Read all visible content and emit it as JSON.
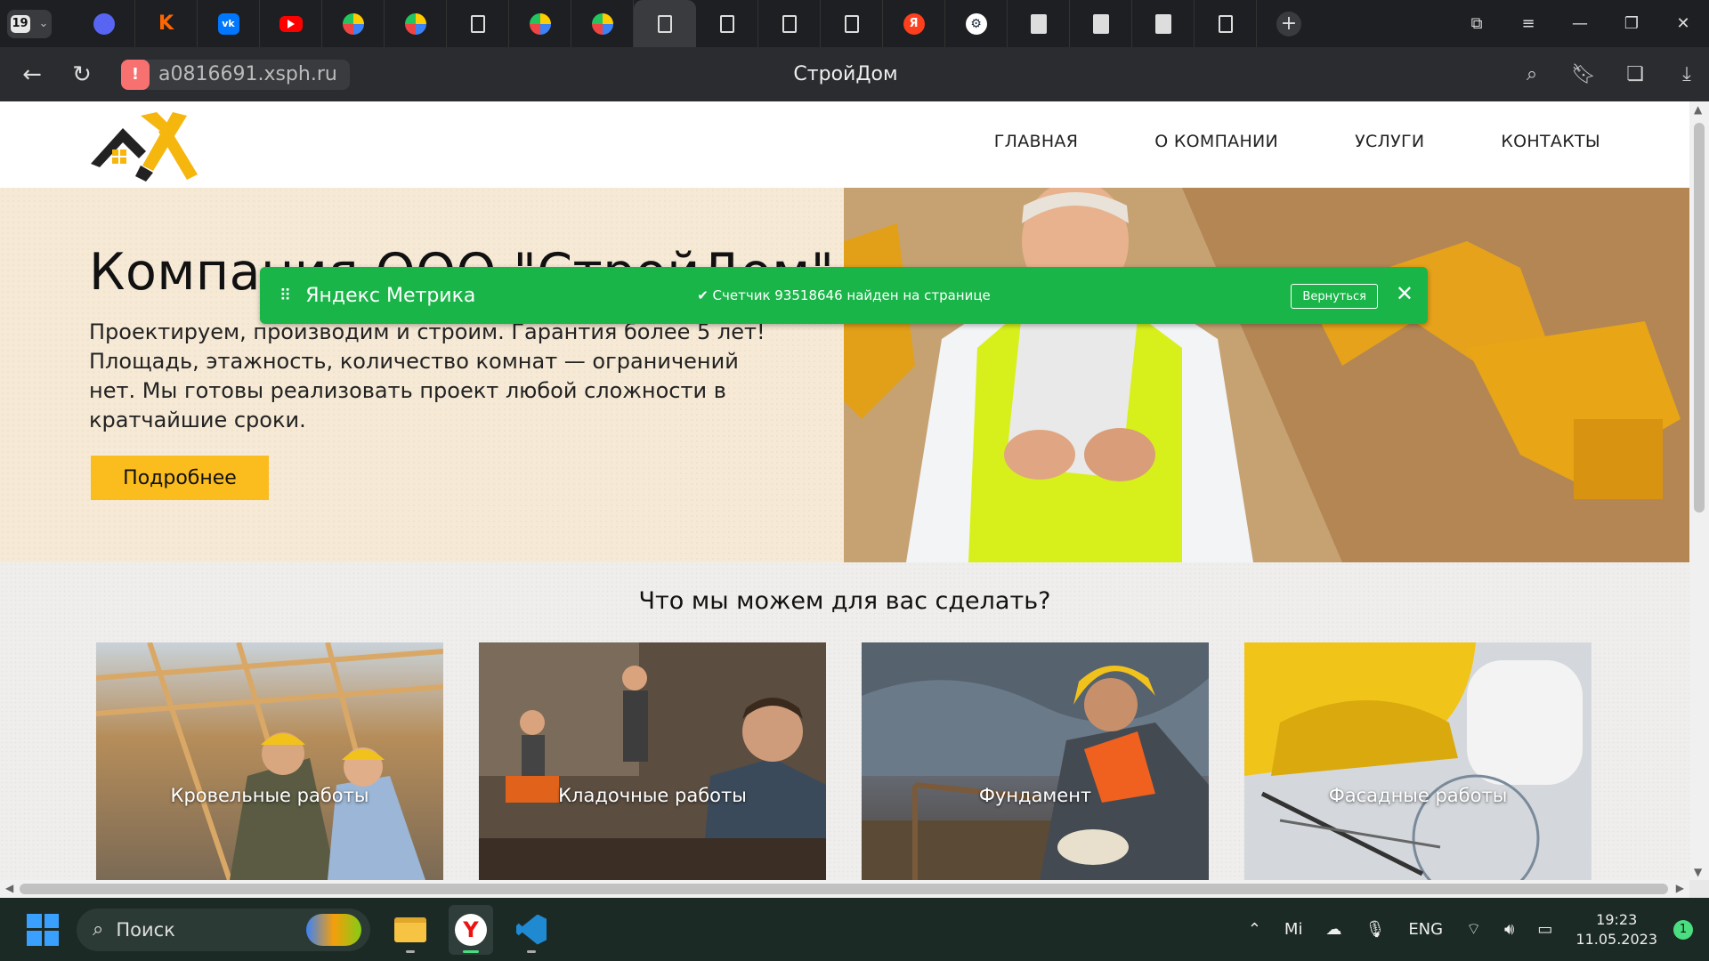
{
  "browser": {
    "tab_count": "19",
    "page_title": "СтройДом",
    "url": "a0816691.xsph.ru",
    "tabs": [
      {
        "icon": "discord-icon",
        "active": false
      },
      {
        "icon": "kinopoisk-icon",
        "active": false
      },
      {
        "icon": "vk-icon",
        "glyph": "vk",
        "active": false
      },
      {
        "icon": "youtube-icon",
        "active": false
      },
      {
        "icon": "yandex-services-icon",
        "active": false
      },
      {
        "icon": "yandex-services-icon",
        "active": false
      },
      {
        "icon": "page-icon",
        "active": false
      },
      {
        "icon": "yandex-services-icon",
        "active": false
      },
      {
        "icon": "yandex-services-icon",
        "active": false
      },
      {
        "icon": "page-icon",
        "active": true
      },
      {
        "icon": "page-icon",
        "active": false
      },
      {
        "icon": "page-icon",
        "active": false
      },
      {
        "icon": "page-icon",
        "active": false
      },
      {
        "icon": "yandex-icon",
        "glyph": "Я",
        "active": false
      },
      {
        "icon": "steam-icon",
        "active": false
      },
      {
        "icon": "page-filled-icon",
        "active": false
      },
      {
        "icon": "page-filled-icon",
        "active": false
      },
      {
        "icon": "page-filled-icon",
        "active": false
      },
      {
        "icon": "page-icon",
        "active": false
      }
    ]
  },
  "site": {
    "nav": [
      "ГЛАВНАЯ",
      "О КОМПАНИИ",
      "УСЛУГИ",
      "КОНТАКТЫ"
    ],
    "hero": {
      "title": "Компания ООО \"СтройДом\"",
      "text": "Проектируем, производим и строим. Гарантия более 5 лет! Площадь, этажность, количество комнат — ограничений нет. Мы готовы реализовать проект любой сложности в кратчайшие сроки.",
      "button": "Подробнее"
    },
    "services": {
      "title": "Что мы можем для вас сделать?",
      "cards": [
        "Кровельные работы",
        "Кладочные работы",
        "Фундамент",
        "Фасадные работы"
      ]
    },
    "accent": "#fbbd1e"
  },
  "metrika": {
    "brand": "Яндекс Метрика",
    "message": "Счетчик 93518646 найден на странице",
    "return_button": "Вернуться",
    "color": "#19b548"
  },
  "taskbar": {
    "search_placeholder": "Поиск",
    "lang": "ENG",
    "time": "19:23",
    "date": "11.05.2023",
    "notifications": "1"
  }
}
